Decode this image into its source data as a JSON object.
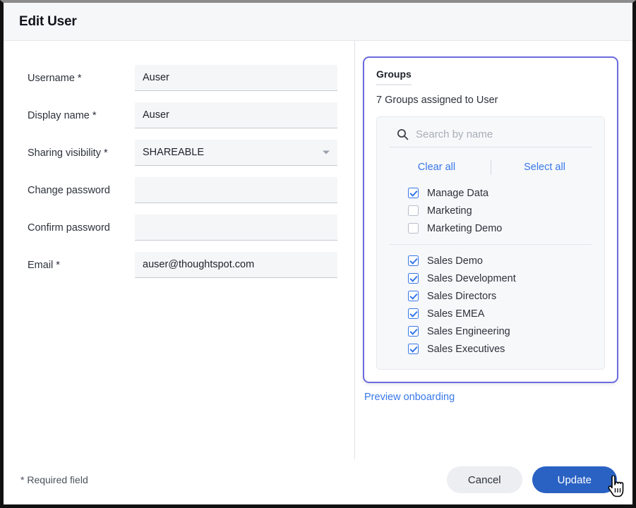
{
  "dialog": {
    "title": "Edit User"
  },
  "form": {
    "fields": [
      {
        "label": "Username *",
        "value": "Auser",
        "type": "text",
        "empty": false
      },
      {
        "label": "Display name *",
        "value": "Auser",
        "type": "text",
        "empty": false
      },
      {
        "label": "Sharing visibility *",
        "value": "SHAREABLE",
        "type": "select",
        "empty": false
      },
      {
        "label": "Change password",
        "value": "",
        "type": "password",
        "empty": true
      },
      {
        "label": "Confirm password",
        "value": "",
        "type": "password",
        "empty": true
      },
      {
        "label": "Email *",
        "value": "auser@thoughtspot.com",
        "type": "text",
        "empty": false
      }
    ]
  },
  "groups": {
    "tab_label": "Groups",
    "assigned_text": "7 Groups assigned to User",
    "search_placeholder": "Search by name",
    "search_value": "",
    "clear_all_label": "Clear all",
    "select_all_label": "Select all",
    "items_top": [
      {
        "label": "Manage Data",
        "checked": true
      },
      {
        "label": "Marketing",
        "checked": false
      },
      {
        "label": "Marketing Demo",
        "checked": false
      }
    ],
    "items_bottom": [
      {
        "label": "Sales Demo",
        "checked": true
      },
      {
        "label": "Sales Development",
        "checked": true
      },
      {
        "label": "Sales Directors",
        "checked": true
      },
      {
        "label": "Sales EMEA",
        "checked": true
      },
      {
        "label": "Sales Engineering",
        "checked": true
      },
      {
        "label": "Sales Executives",
        "checked": true
      }
    ],
    "preview_link_label": "Preview onboarding"
  },
  "footer": {
    "required_note": "* Required field",
    "cancel_label": "Cancel",
    "update_label": "Update"
  },
  "icons": {
    "search": "search-icon",
    "caret": "chevron-down-icon",
    "cursor": "pointer-hand-cursor"
  },
  "colors": {
    "accent_border": "#6b6bdf",
    "link": "#3778e8",
    "primary_button": "#2a62c4",
    "checkbox_on": "#3778e8",
    "field_bg": "#f5f6f8"
  }
}
